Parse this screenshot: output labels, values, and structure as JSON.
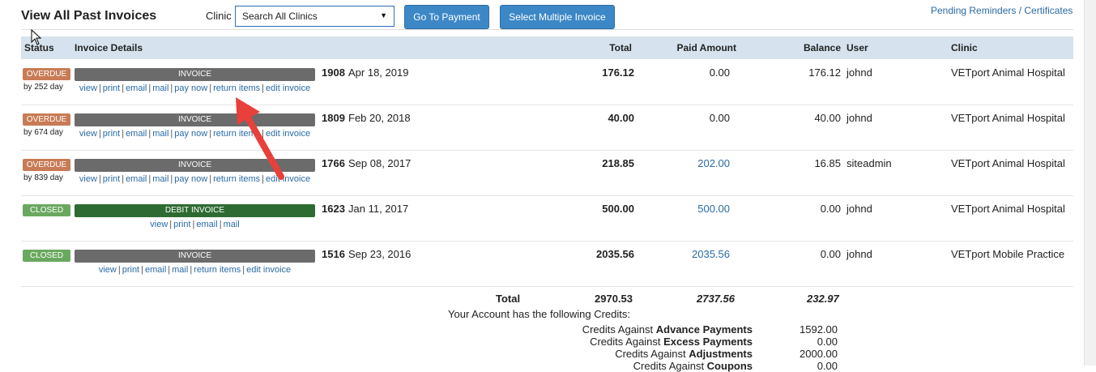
{
  "page": {
    "title": "View All Past Invoices",
    "clinic_label": "Clinic",
    "clinic_select_value": "Search All Clinics",
    "go_to_payment": "Go To Payment",
    "select_multiple": "Select Multiple Invoice",
    "pending_link": "Pending Reminders / Certificates"
  },
  "columns": {
    "status": "Status",
    "details": "Invoice Details",
    "total": "Total",
    "paid": "Paid Amount",
    "balance": "Balance",
    "user": "User",
    "clinic": "Clinic"
  },
  "invoices": [
    {
      "status": "OVERDUE",
      "age": "by 252 day",
      "type": "INVOICE",
      "number": "1908",
      "date": "Apr 18, 2019",
      "total": "176.12",
      "paid": "0.00",
      "balance": "176.12",
      "user": "johnd",
      "clinic": "VETport Animal Hospital",
      "actions": [
        "view",
        "print",
        "email",
        "mail",
        "pay now",
        "return items",
        "edit invoice"
      ]
    },
    {
      "status": "OVERDUE",
      "age": "by 674 day",
      "type": "INVOICE",
      "number": "1809",
      "date": "Feb 20, 2018",
      "total": "40.00",
      "paid": "0.00",
      "balance": "40.00",
      "user": "johnd",
      "clinic": "VETport Animal Hospital",
      "actions": [
        "view",
        "print",
        "email",
        "mail",
        "pay now",
        "return items",
        "edit invoice"
      ]
    },
    {
      "status": "OVERDUE",
      "age": "by 839 day",
      "type": "INVOICE",
      "number": "1766",
      "date": "Sep 08, 2017",
      "total": "218.85",
      "paid": "202.00",
      "balance": "16.85",
      "user": "siteadmin",
      "clinic": "VETport Animal Hospital",
      "actions": [
        "view",
        "print",
        "email",
        "mail",
        "pay now",
        "return items",
        "edit invoice"
      ]
    },
    {
      "status": "CLOSED",
      "age": "",
      "type": "DEBIT INVOICE",
      "number": "1623",
      "date": "Jan 11, 2017",
      "total": "500.00",
      "paid": "500.00",
      "balance": "0.00",
      "user": "johnd",
      "clinic": "VETport Animal Hospital",
      "actions": [
        "view",
        "print",
        "email",
        "mail"
      ]
    },
    {
      "status": "CLOSED",
      "age": "",
      "type": "INVOICE",
      "number": "1516",
      "date": "Sep 23, 2016",
      "total": "2035.56",
      "paid": "2035.56",
      "balance": "0.00",
      "user": "johnd",
      "clinic": "VETport Mobile Practice",
      "actions": [
        "view",
        "print",
        "email",
        "mail",
        "return items",
        "edit invoice"
      ]
    }
  ],
  "totals": {
    "label": "Total",
    "total": "2970.53",
    "paid": "2737.56",
    "balance": "232.97"
  },
  "credits": {
    "heading": "Your Account has the following Credits:",
    "items": [
      {
        "prefix": "Credits Against ",
        "bold": "Advance Payments",
        "amount": "1592.00"
      },
      {
        "prefix": "Credits Against ",
        "bold": "Excess Payments",
        "amount": "0.00"
      },
      {
        "prefix": "Credits Against ",
        "bold": "Adjustments",
        "amount": "2000.00"
      },
      {
        "prefix": "Credits Against ",
        "bold": "Coupons",
        "amount": "0.00"
      }
    ]
  },
  "colors": {
    "overdue": "#c87b55",
    "closed": "#6aa860",
    "invoice_bar": "#6b6b6b",
    "debit_bar": "#2e6b32",
    "link": "#2a6aa5",
    "button": "#3c87c6",
    "header_bg": "#d6e3ee",
    "annotation": "#e8403a"
  },
  "icons": {
    "dropdown": "caret-down-icon",
    "cursor": "mouse-pointer-icon",
    "annotation": "red-arrow-icon"
  }
}
